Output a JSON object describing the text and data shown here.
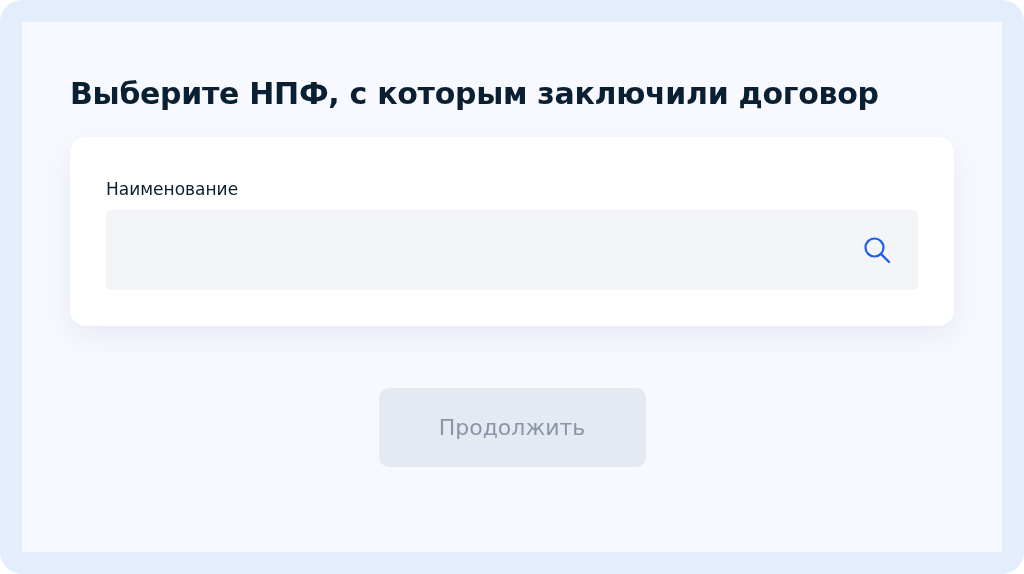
{
  "title": "Выберите НПФ, с которым заключили договор",
  "search": {
    "label": "Наименование"
  },
  "continue_button": {
    "label": "Продолжить",
    "disabled": true
  }
}
